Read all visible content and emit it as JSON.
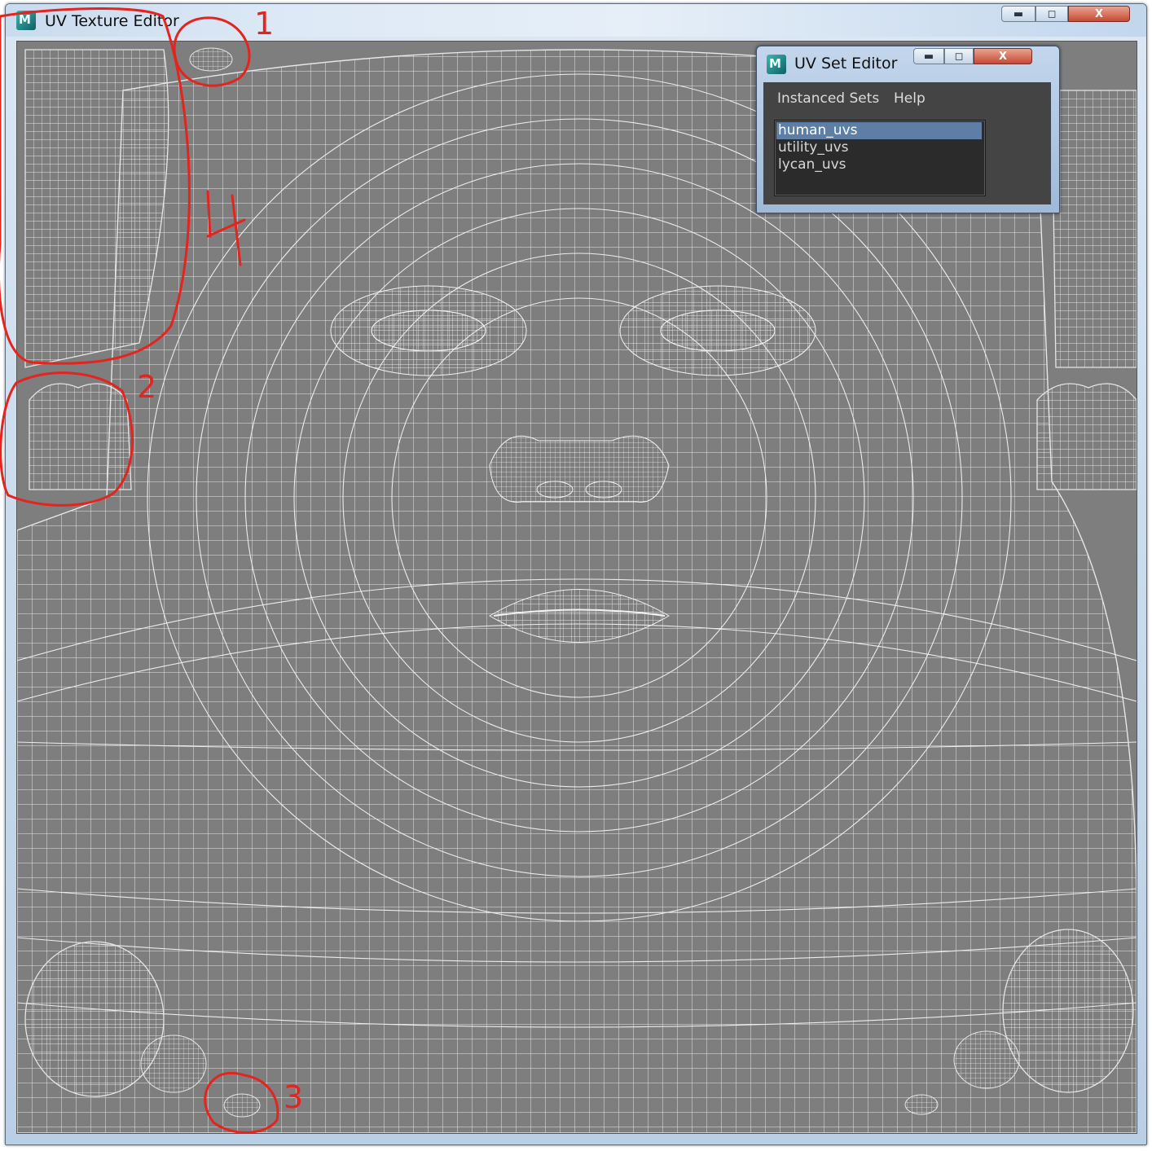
{
  "main_window": {
    "title": "UV Texture Editor",
    "buttons": {
      "minimize": "▬",
      "maximize": "◻",
      "close": "X"
    }
  },
  "uv_set_editor": {
    "title": "UV Set Editor",
    "menu": [
      "Instanced Sets",
      "Help"
    ],
    "sets": [
      "human_uvs",
      "utility_uvs",
      "lycan_uvs"
    ],
    "selected": "human_uvs"
  },
  "annotations": [
    "1",
    "2",
    "3",
    "4"
  ],
  "colors": {
    "viewport_bg": "#7e7e7e",
    "wire": "#e6e6e6",
    "annotation": "#e3241f",
    "selection": "#5d7fa6"
  }
}
